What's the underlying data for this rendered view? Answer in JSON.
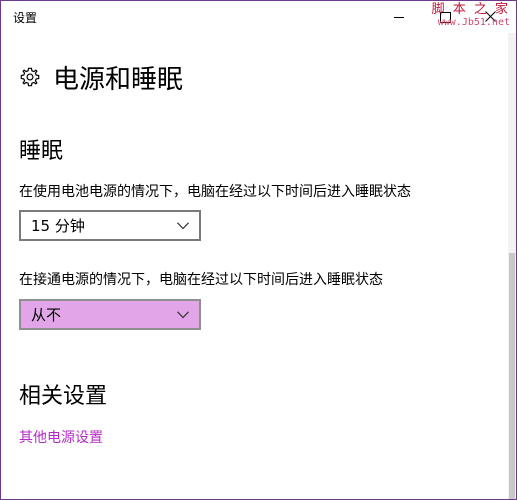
{
  "window": {
    "title": "设置"
  },
  "watermark": {
    "line1": "脚 本 之 家",
    "line2": "www.Jb51.net"
  },
  "header": {
    "title": "电源和睡眠"
  },
  "sleep": {
    "section_title": "睡眠",
    "battery_label": "在使用电池电源的情况下，电脑在经过以下时间后进入睡眠状态",
    "battery_value": "15 分钟",
    "plugged_label": "在接通电源的情况下，电脑在经过以下时间后进入睡眠状态",
    "plugged_value": "从不"
  },
  "related": {
    "section_title": "相关设置",
    "link_label": "其他电源设置"
  },
  "colors": {
    "accent": "#b52bc7",
    "dropdown_highlight": "#e2a6e8",
    "window_border": "#6b3a8a"
  }
}
